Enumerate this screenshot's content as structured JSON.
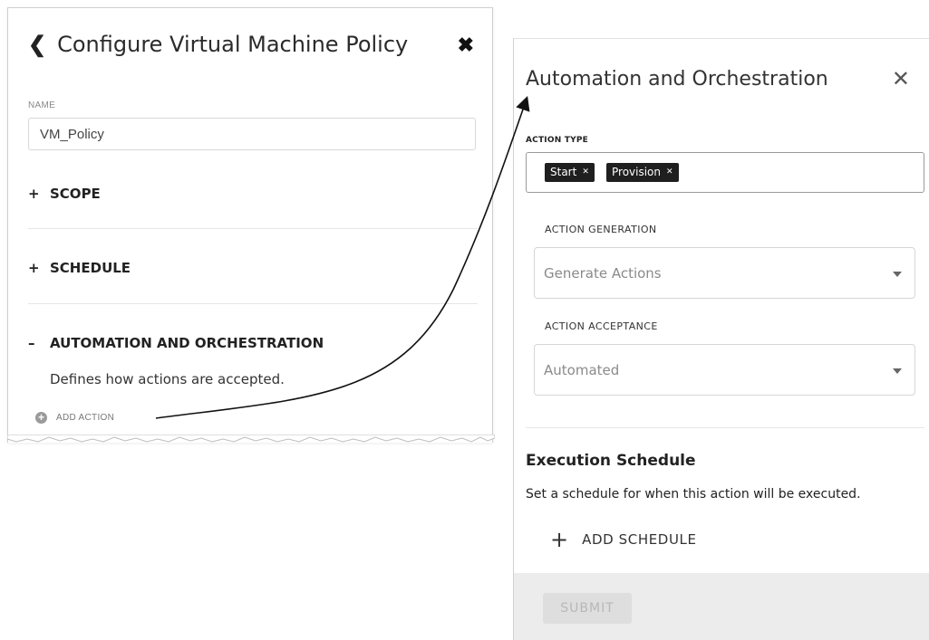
{
  "left_card": {
    "title": "Configure Virtual Machine Policy",
    "name_label": "NAME",
    "name_value": "VM_Policy",
    "sections": [
      {
        "sign": "+",
        "label": "SCOPE"
      },
      {
        "sign": "+",
        "label": "SCHEDULE"
      },
      {
        "sign": "–",
        "label": "AUTOMATION AND ORCHESTRATION"
      }
    ],
    "automation_desc": "Defines how actions are accepted.",
    "add_action_label": "ADD ACTION"
  },
  "right_panel": {
    "title": "Automation and Orchestration",
    "action_type_label": "ACTION TYPE",
    "action_type_tags": [
      "Start",
      "Provision"
    ],
    "action_generation_label": "ACTION GENERATION",
    "action_generation_value": "Generate Actions",
    "action_acceptance_label": "ACTION ACCEPTANCE",
    "action_acceptance_value": "Automated",
    "execution_title": "Execution Schedule",
    "execution_desc": "Set a schedule for when this action will be executed.",
    "add_schedule_label": "ADD SCHEDULE",
    "submit_label": "SUBMIT"
  },
  "icons": {
    "back": "chevron-left-icon",
    "close_left": "close-icon",
    "close_right": "close-icon",
    "add_action": "plus-circle-icon",
    "tag_remove": "remove-tag-icon",
    "dropdown": "caret-down-icon",
    "add_schedule": "plus-icon"
  }
}
